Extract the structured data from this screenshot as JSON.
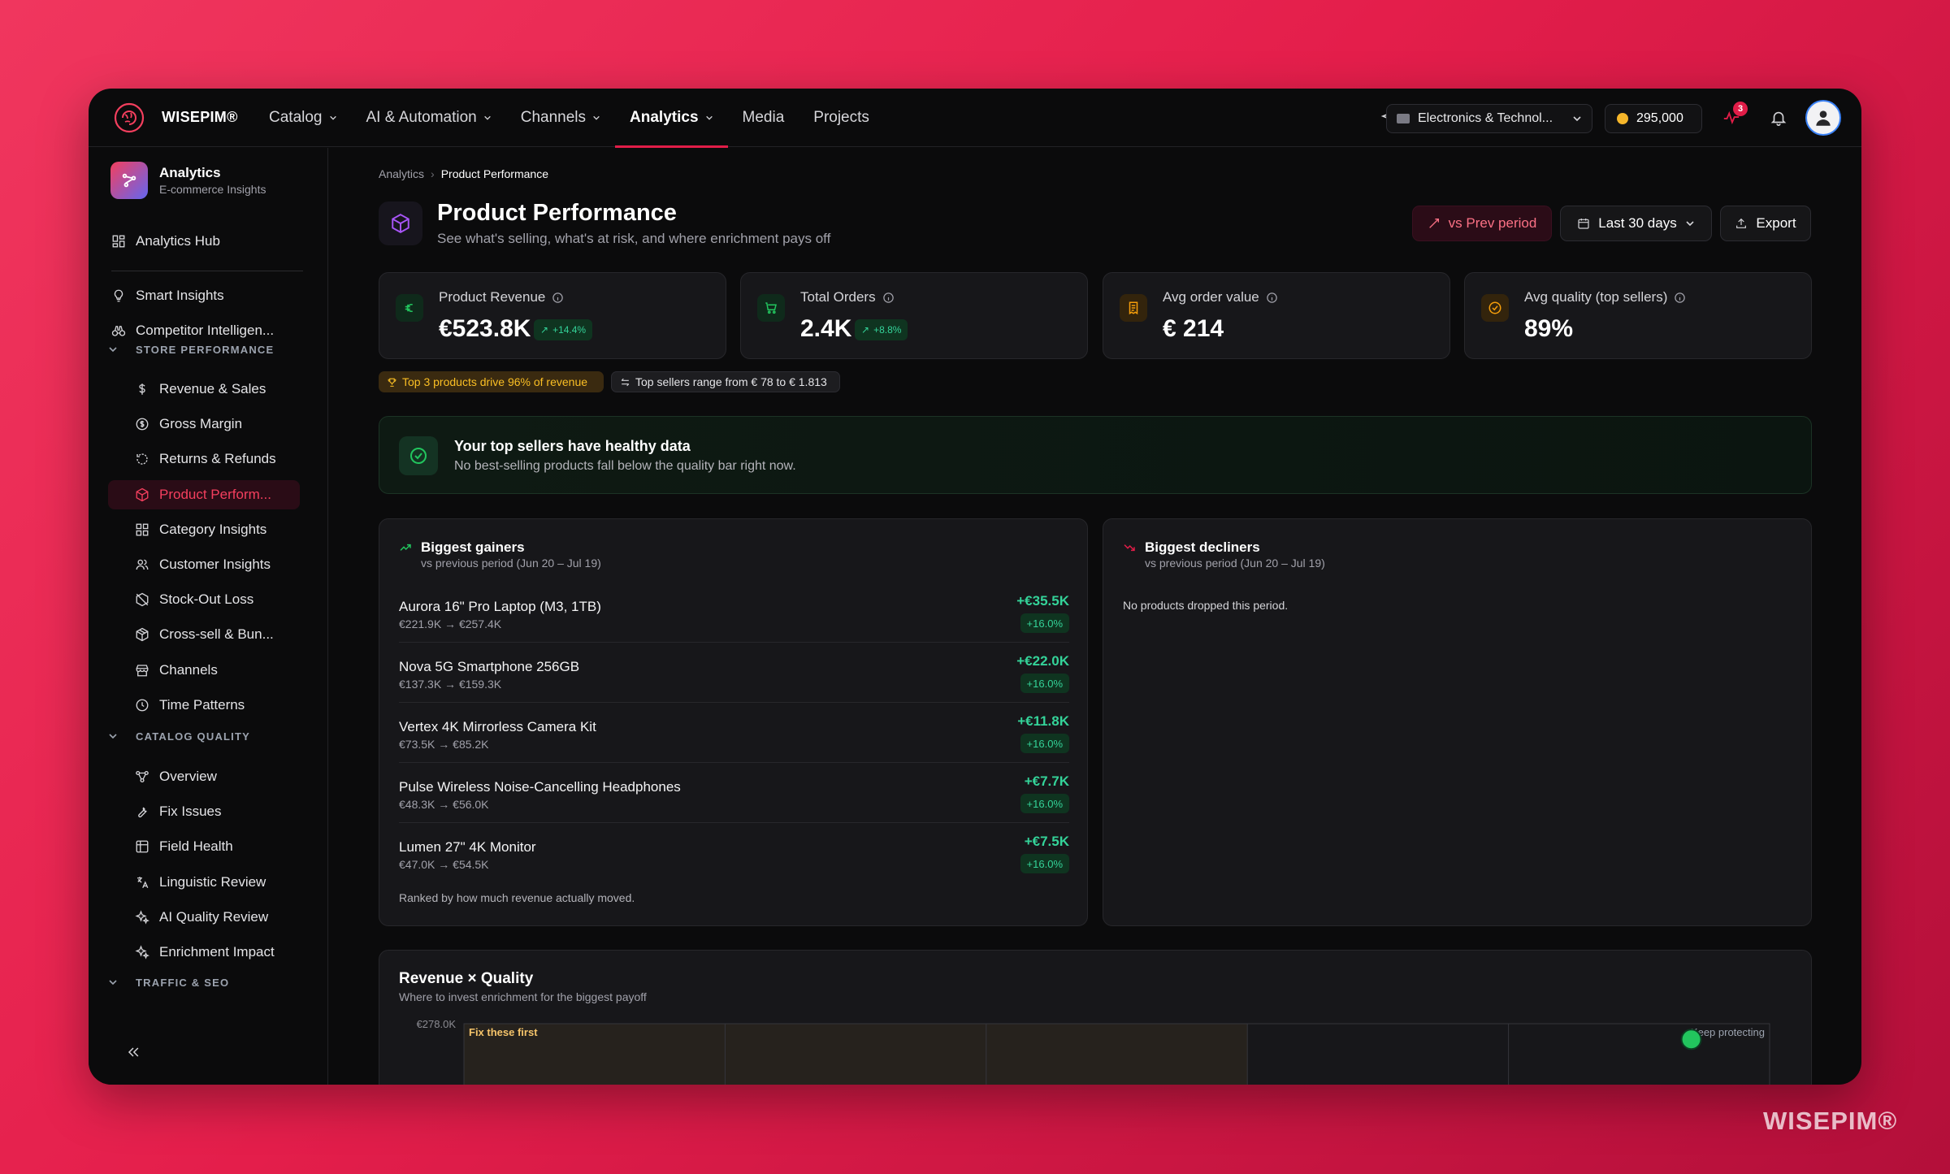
{
  "brand": {
    "name": "WISEPIM®",
    "watermark": "WISEPIM®"
  },
  "nav": {
    "items": [
      {
        "label": "Catalog",
        "dropdown": true
      },
      {
        "label": "AI & Automation",
        "dropdown": true
      },
      {
        "label": "Channels",
        "dropdown": true
      },
      {
        "label": "Analytics",
        "dropdown": true,
        "active": true
      },
      {
        "label": "Media",
        "dropdown": false
      },
      {
        "label": "Projects",
        "dropdown": false
      }
    ]
  },
  "topbar": {
    "store": "Electronics & Technol...",
    "credits": "295,000",
    "notifications_count": "3"
  },
  "sidebar": {
    "header": {
      "title": "Analytics",
      "subtitle": "E-commerce Insights"
    },
    "hub": "Analytics Hub",
    "top_items": [
      "Smart Insights",
      "Competitor Intelligen..."
    ],
    "sections": [
      {
        "title": "STORE PERFORMANCE",
        "items": [
          {
            "label": "Revenue & Sales",
            "icon": "dollar-icon"
          },
          {
            "label": "Gross Margin",
            "icon": "coin-icon"
          },
          {
            "label": "Returns & Refunds",
            "icon": "return-icon"
          },
          {
            "label": "Product Perform...",
            "icon": "box-icon",
            "active": true
          },
          {
            "label": "Category Insights",
            "icon": "grid-icon"
          },
          {
            "label": "Customer Insights",
            "icon": "users-icon"
          },
          {
            "label": "Stock-Out Loss",
            "icon": "box-off-icon"
          },
          {
            "label": "Cross-sell & Bun...",
            "icon": "package-icon"
          },
          {
            "label": "Channels",
            "icon": "store-icon"
          },
          {
            "label": "Time Patterns",
            "icon": "clock-icon"
          }
        ]
      },
      {
        "title": "CATALOG QUALITY",
        "items": [
          {
            "label": "Overview",
            "icon": "network-icon"
          },
          {
            "label": "Fix Issues",
            "icon": "wrench-icon"
          },
          {
            "label": "Field Health",
            "icon": "table-icon"
          },
          {
            "label": "Linguistic Review",
            "icon": "translate-icon"
          },
          {
            "label": "AI Quality Review",
            "icon": "sparkles-icon"
          },
          {
            "label": "Enrichment Impact",
            "icon": "sparkles-icon"
          }
        ]
      },
      {
        "title": "TRAFFIC & SEO",
        "items": []
      }
    ]
  },
  "page": {
    "breadcrumb": [
      "Analytics",
      "Product Performance"
    ],
    "title": "Product Performance",
    "subtitle": "See what's selling, what's at risk, and where enrichment pays off",
    "buttons": {
      "compare": "vs Prev period",
      "range": "Last 30 days",
      "export": "Export"
    }
  },
  "kpis": [
    {
      "label": "Product Revenue",
      "value": "€523.8K",
      "delta": "+14.4%",
      "icon": "euro-icon",
      "color": "#22c55e"
    },
    {
      "label": "Total Orders",
      "value": "2.4K",
      "delta": "+8.8%",
      "icon": "cart-icon",
      "color": "#22c55e"
    },
    {
      "label": "Avg order value",
      "value": "€ 214",
      "delta": "",
      "icon": "receipt-icon",
      "color": "#f59e0b"
    },
    {
      "label": "Avg quality (top sellers)",
      "value": "89%",
      "delta": "",
      "icon": "badge-check-icon",
      "color": "#f59e0b"
    }
  ],
  "chips": {
    "top3": "Top 3 products drive 96% of revenue",
    "range": "Top sellers range from € 78 to € 1.813"
  },
  "banner": {
    "title": "Your top sellers have healthy data",
    "subtitle": "No best-selling products fall below the quality bar right now."
  },
  "gainers": {
    "title": "Biggest gainers",
    "subtitle": "vs previous period (Jun 20 – Jul 19)",
    "rows": [
      {
        "name": "Aurora 16\" Pro Laptop (M3, 1TB)",
        "range": "€221.9K → €257.4K",
        "amount": "+€35.5K",
        "pct": "+16.0%"
      },
      {
        "name": "Nova 5G Smartphone 256GB",
        "range": "€137.3K → €159.3K",
        "amount": "+€22.0K",
        "pct": "+16.0%"
      },
      {
        "name": "Vertex 4K Mirrorless Camera Kit",
        "range": "€73.5K → €85.2K",
        "amount": "+€11.8K",
        "pct": "+16.0%"
      },
      {
        "name": "Pulse Wireless Noise-Cancelling Headphones",
        "range": "€48.3K → €56.0K",
        "amount": "+€7.7K",
        "pct": "+16.0%"
      },
      {
        "name": "Lumen 27\" 4K Monitor",
        "range": "€47.0K → €54.5K",
        "amount": "+€7.5K",
        "pct": "+16.0%"
      }
    ],
    "footer": "Ranked by how much revenue actually moved."
  },
  "decliners": {
    "title": "Biggest decliners",
    "subtitle": "vs previous period (Jun 20 – Jul 19)",
    "empty": "No products dropped this period."
  },
  "chart_data": {
    "type": "scatter",
    "title": "Revenue × Quality",
    "subtitle": "Where to invest enrichment for the biggest payoff",
    "ytick_top": "€278.0K",
    "quadrants": {
      "top_left": "Fix these first",
      "top_right": "Keep protecting"
    },
    "columns": 5,
    "highlight_color": "#22c55e",
    "points": [
      {
        "x": 0.94,
        "y": 257.4
      }
    ]
  }
}
